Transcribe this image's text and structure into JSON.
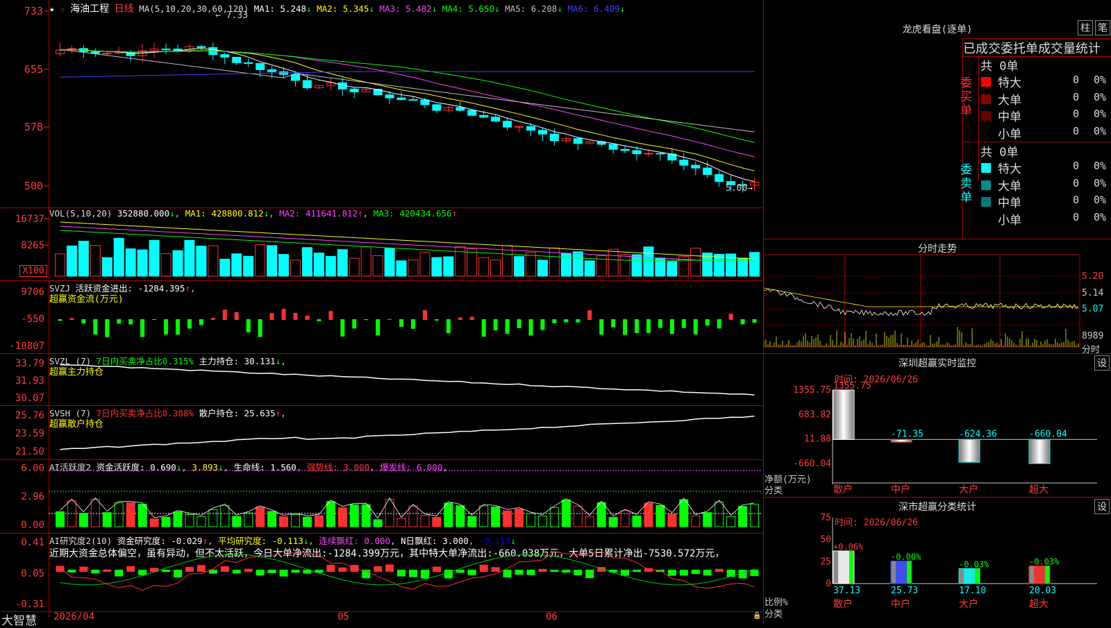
{
  "main": {
    "stock_name": "海油工程",
    "period": "日线",
    "ma_label": "MA(5,10,20,30,60,120)",
    "ma_values": [
      {
        "name": "MA1:",
        "value": "5.248",
        "arrow": "↓",
        "color": "#ffffff"
      },
      {
        "name": "MA2:",
        "value": "5.345",
        "arrow": "↓",
        "color": "#ffff00"
      },
      {
        "name": "MA3:",
        "value": "5.482",
        "arrow": "↓",
        "color": "#ff40ff"
      },
      {
        "name": "MA4:",
        "value": "5.650",
        "arrow": "↓",
        "color": "#00ff00"
      },
      {
        "name": "MA5:",
        "value": "6.208",
        "arrow": "↓",
        "color": "#c0c0c0"
      },
      {
        "name": "MA6:",
        "value": "6.409",
        "arrow": "↓",
        "color": "#4040ff"
      }
    ],
    "yticks": [
      "733",
      "655",
      "578",
      "500"
    ],
    "high_label": "7.33",
    "low_label": "5.00",
    "bottom_label": "大智慧",
    "date_labels": [
      "2026/04",
      "05",
      "06"
    ]
  },
  "vol": {
    "label": "VOL(5,10,20)",
    "value": "352880.000",
    "ma1": "428800.812",
    "ma2": "411641.812",
    "ma3": "420434.656",
    "yticks": [
      "16737",
      "8265",
      "X100"
    ]
  },
  "svzj": {
    "label": "SVZJ",
    "title": "活跃资金进出:",
    "value": "-1284.395",
    "subtitle": "超赢资金流(万元)",
    "yticks": [
      "9706",
      "-550",
      "-10807"
    ]
  },
  "svzl": {
    "label": "SVZL (7)",
    "pct_text": "7日内买卖净占比0.315%",
    "hold_text": "主力持仓:",
    "value": "30.131",
    "subtitle": "超赢主力持仓",
    "yticks": [
      "33.79",
      "31.93",
      "30.07"
    ]
  },
  "svsh": {
    "label": "SVSH (7)",
    "pct_text": "7日内买卖净占比0.388%",
    "hold_text": "散户持仓:",
    "value": "25.635",
    "subtitle": "超赢散户持仓",
    "yticks": [
      "25.76",
      "23.59",
      "21.50"
    ]
  },
  "ai1": {
    "label": "AI活跃度2",
    "t1": "资金活跃度:",
    "v1": "0.690",
    "v2": "3.893",
    "t3": "生命线:",
    "v3": "1.560",
    "t4": "强势线:",
    "v4": "3.000",
    "t5": "爆发线:",
    "v5": "6.000",
    "yticks": [
      "6.00",
      "2.96",
      "0.00"
    ]
  },
  "ai2": {
    "label": "AI研究度2(10)",
    "t1": "资金研究度:",
    "v1": "-0.029",
    "t2": "平均研究度:",
    "v2": "-0.113",
    "t3": "连续飘红:",
    "v3": "0.000",
    "t4": "N日飘红:",
    "v4": "3.000",
    "v5": "-0.113",
    "comment": "近期大资金总体偏空，虽有异动，但不太活跃，今日大单净流出:-1284.399万元，其中特大单净流出:-660.038万元，大单5日累计净出-7530.572万元，",
    "yticks": [
      "0.41",
      "0.05",
      "-0.31"
    ]
  },
  "dragon": {
    "title": "龙虎看盘(逐单)",
    "btn1": "柱",
    "btn2": "笔",
    "tabs_text": "已成交委托单成交量统计",
    "buy_side": "委买单",
    "sell_side": "委卖单",
    "buy_total": "共 0单",
    "sell_total": "共 0单",
    "rows_buy": [
      {
        "label": "特大",
        "count": "0",
        "pct": "0%",
        "color": "#ff0000"
      },
      {
        "label": "大单",
        "count": "0",
        "pct": "0%",
        "color": "#8b0000"
      },
      {
        "label": "中单",
        "count": "0",
        "pct": "0%",
        "color": "#6b0000"
      },
      {
        "label": "小单",
        "count": "0",
        "pct": "0%",
        "color": ""
      }
    ],
    "rows_sell": [
      {
        "label": "特大",
        "count": "0",
        "pct": "0%",
        "color": "#00ffff"
      },
      {
        "label": "大单",
        "count": "0",
        "pct": "0%",
        "color": "#008b8b"
      },
      {
        "label": "中单",
        "count": "0",
        "pct": "0%",
        "color": "#007a7a"
      },
      {
        "label": "小单",
        "count": "0",
        "pct": "0%",
        "color": ""
      }
    ]
  },
  "minute": {
    "title": "分时走势",
    "yticks": [
      "5.20",
      "5.14",
      "5.07"
    ],
    "vol_label": "8989",
    "bottom_label": "分时"
  },
  "monitor": {
    "title": "深圳超赢实时监控",
    "btn": "设",
    "time": "时间: 2026/06/26",
    "yticks": [
      "1355.75",
      "683.82",
      "11.88",
      "-660.04"
    ],
    "ylabel1": "净额(万元)",
    "ylabel2": "分类",
    "bars": [
      {
        "cat": "散户",
        "value": 1355.75,
        "label": "1355.75"
      },
      {
        "cat": "中户",
        "value": -71.35,
        "label": "-71.35"
      },
      {
        "cat": "大户",
        "value": -624.36,
        "label": "-624.36"
      },
      {
        "cat": "超大",
        "value": -660.04,
        "label": "-660.04"
      }
    ]
  },
  "classify": {
    "title": "深市超赢分类统计",
    "btn": "设",
    "time": "时间: 2026/06/26",
    "yticks": [
      "75",
      "50",
      "25",
      "0"
    ],
    "ylabel1": "比例%",
    "ylabel2": "分类",
    "bars": [
      {
        "cat": "散户",
        "value": 37.13,
        "delta": "+0.06%",
        "color": "#ffffff"
      },
      {
        "cat": "中户",
        "value": 25.73,
        "delta": "-0.00%",
        "color": "#3040ff"
      },
      {
        "cat": "大户",
        "value": 17.1,
        "delta": "-0.03%",
        "color": "#00ffff"
      },
      {
        "cat": "超大",
        "value": 20.03,
        "delta": "-0.03%",
        "color": "#ff2020"
      }
    ]
  }
}
